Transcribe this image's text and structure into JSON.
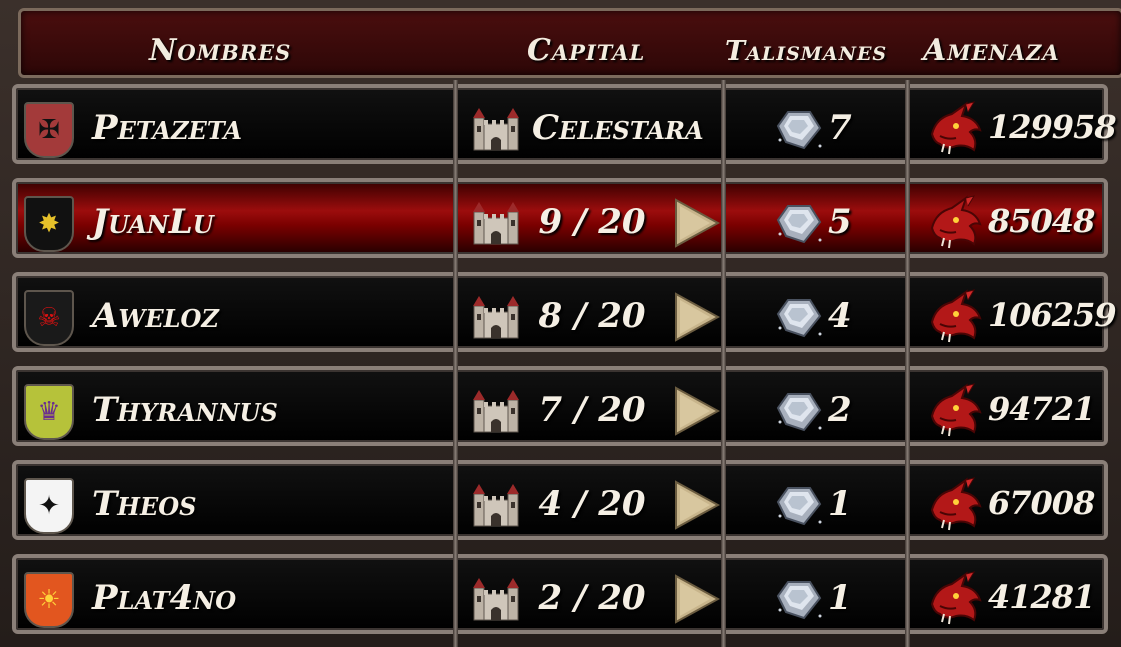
{
  "header": {
    "name_col": "Nombres",
    "capital_col": "Capital",
    "talismans_col": "Talismanes",
    "threat_col": "Amenaza"
  },
  "rows": [
    {
      "name": "Petazeta",
      "capital": "Celestara",
      "talismans": "7",
      "threat": "129958",
      "selected": false,
      "has_arrow": false,
      "crest_color": "#a33a3a",
      "crest_icon": "black-eagle-icon"
    },
    {
      "name": "JuanLu",
      "capital": "9 / 20",
      "talismans": "5",
      "threat": "85048",
      "selected": true,
      "has_arrow": true,
      "crest_color": "#111111",
      "crest_icon": "gold-emblem-icon"
    },
    {
      "name": "Aweloz",
      "capital": "8 / 20",
      "talismans": "4",
      "threat": "106259",
      "selected": false,
      "has_arrow": true,
      "crest_color": "#1a1a1a",
      "crest_icon": "red-dragon-skull-icon"
    },
    {
      "name": "Thyrannus",
      "capital": "7 / 20",
      "talismans": "2",
      "threat": "94721",
      "selected": false,
      "has_arrow": true,
      "crest_color": "#b6c23a",
      "crest_icon": "purple-crown-icon"
    },
    {
      "name": "Theos",
      "capital": "4 / 20",
      "talismans": "1",
      "threat": "67008",
      "selected": false,
      "has_arrow": true,
      "crest_color": "#f4f4f4",
      "crest_icon": "black-phoenix-icon"
    },
    {
      "name": "Plat4no",
      "capital": "2 / 20",
      "talismans": "1",
      "threat": "41281",
      "selected": false,
      "has_arrow": true,
      "crest_color": "#e2561f",
      "crest_icon": "sun-icon"
    }
  ]
}
